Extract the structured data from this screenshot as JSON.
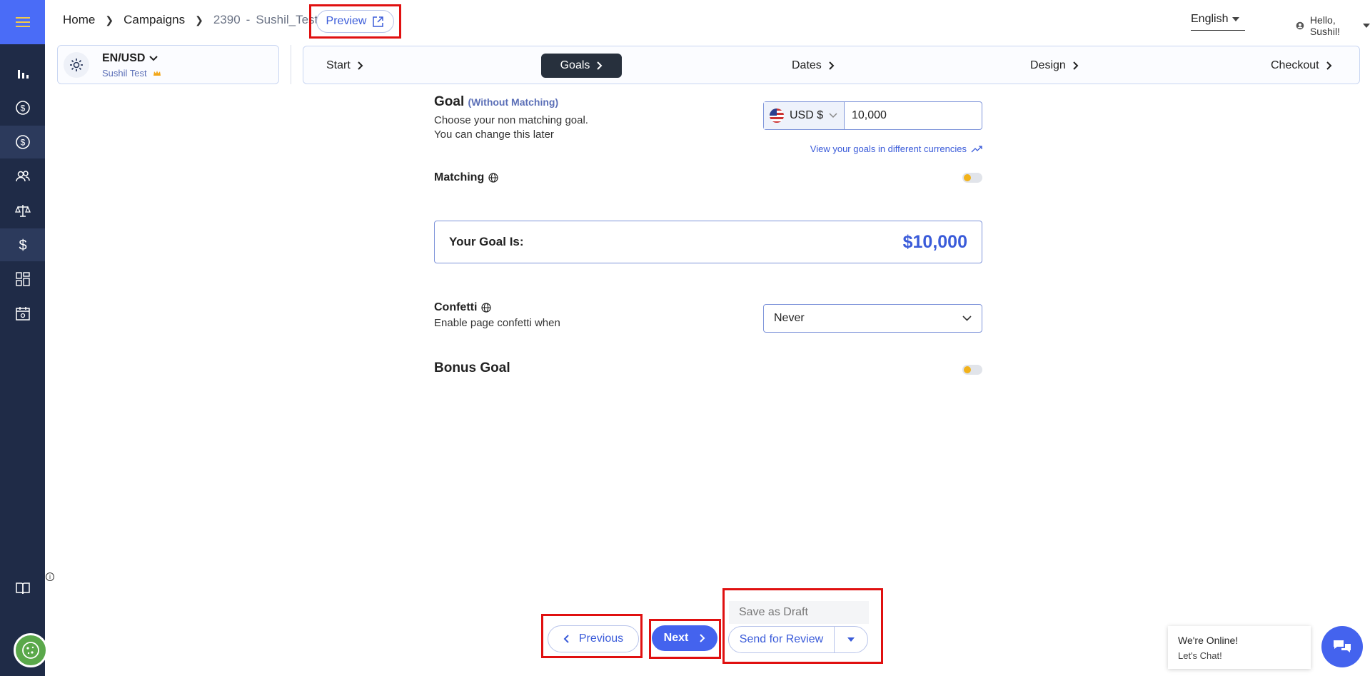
{
  "header": {
    "breadcrumb": {
      "home": "Home",
      "campaigns": "Campaigns",
      "campaign_id": "2390",
      "dash": "-",
      "campaign_name": "Sushil_Test"
    },
    "preview_label": "Preview",
    "language": "English",
    "greeting": "Hello, Sushil!"
  },
  "campaign_card": {
    "locale": "EN/USD",
    "name": "Sushil Test"
  },
  "steps": [
    {
      "label": "Start",
      "active": false
    },
    {
      "label": "Goals",
      "active": true
    },
    {
      "label": "Dates",
      "active": false
    },
    {
      "label": "Design",
      "active": false
    },
    {
      "label": "Checkout",
      "active": false
    }
  ],
  "goal": {
    "title": "Goal",
    "subtitle": "(Without Matching)",
    "desc_line1": "Choose your non matching goal.",
    "desc_line2": "You can change this later",
    "currency": "USD $",
    "amount": "10,000",
    "view_link": "View your goals in different currencies"
  },
  "matching": {
    "label": "Matching",
    "enabled": false
  },
  "goal_summary": {
    "label": "Your Goal Is:",
    "amount": "$10,000"
  },
  "confetti": {
    "label": "Confetti",
    "desc": "Enable page confetti when",
    "selected": "Never"
  },
  "bonus_goal": {
    "label": "Bonus Goal",
    "enabled": false
  },
  "footer": {
    "previous": "Previous",
    "next": "Next",
    "save_draft": "Save as Draft",
    "send_review": "Send for Review"
  },
  "chat": {
    "line1": "We're Online!",
    "line2": "Let's Chat!"
  },
  "colors": {
    "sidebar": "#1f2b47",
    "accent": "#4463ee",
    "highlight": "#e01010",
    "toggle_knob": "#f2b21a"
  },
  "icons": [
    "menu-icon",
    "chart-icon",
    "dollar-circle-icon",
    "dollar-circle-icon",
    "users-icon",
    "scale-icon",
    "dollar-icon",
    "grid-icon",
    "calendar-icon",
    "book-icon",
    "cookie-icon",
    "chat-icon"
  ]
}
